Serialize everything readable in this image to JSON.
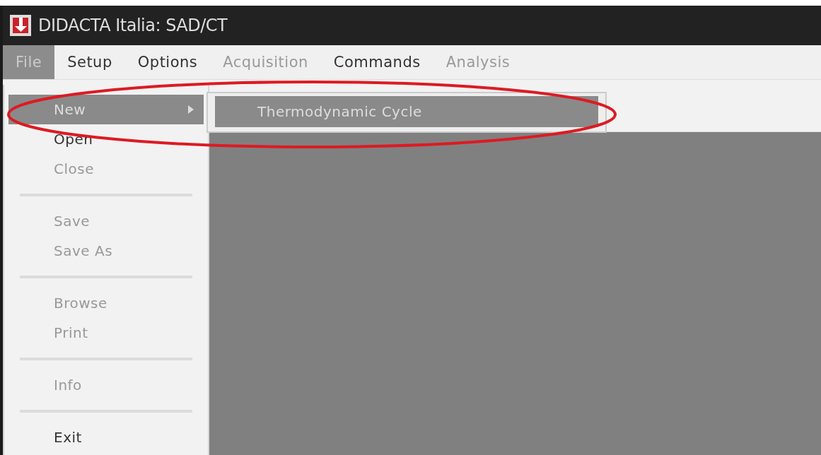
{
  "window": {
    "title": "DIDACTA Italia: SAD/CT"
  },
  "menu_bar": [
    {
      "label": "File",
      "selected": true,
      "disabled": false
    },
    {
      "label": "Setup",
      "selected": false,
      "disabled": false
    },
    {
      "label": "Options",
      "selected": false,
      "disabled": false
    },
    {
      "label": "Acquisition",
      "selected": false,
      "disabled": true
    },
    {
      "label": "Commands",
      "selected": false,
      "disabled": false
    },
    {
      "label": "Analysis",
      "selected": false,
      "disabled": true
    }
  ],
  "file_menu": {
    "items": [
      {
        "kind": "item",
        "label": "New",
        "selected": true,
        "disabled": false,
        "submenu": true
      },
      {
        "kind": "item",
        "label": "Open",
        "selected": false,
        "disabled": false,
        "submenu": false
      },
      {
        "kind": "item",
        "label": "Close",
        "selected": false,
        "disabled": true,
        "submenu": false
      },
      {
        "kind": "separator"
      },
      {
        "kind": "item",
        "label": "Save",
        "selected": false,
        "disabled": true,
        "submenu": false
      },
      {
        "kind": "item",
        "label": "Save As",
        "selected": false,
        "disabled": true,
        "submenu": false
      },
      {
        "kind": "separator"
      },
      {
        "kind": "item",
        "label": "Browse",
        "selected": false,
        "disabled": true,
        "submenu": false
      },
      {
        "kind": "item",
        "label": "Print",
        "selected": false,
        "disabled": true,
        "submenu": false
      },
      {
        "kind": "separator"
      },
      {
        "kind": "item",
        "label": "Info",
        "selected": false,
        "disabled": true,
        "submenu": false
      },
      {
        "kind": "separator"
      },
      {
        "kind": "item",
        "label": "Exit",
        "selected": false,
        "disabled": false,
        "submenu": false
      }
    ]
  },
  "submenu": {
    "items": [
      {
        "label": "Thermodynamic Cycle",
        "selected": true
      }
    ]
  },
  "annotation": {
    "kind": "ellipse"
  }
}
